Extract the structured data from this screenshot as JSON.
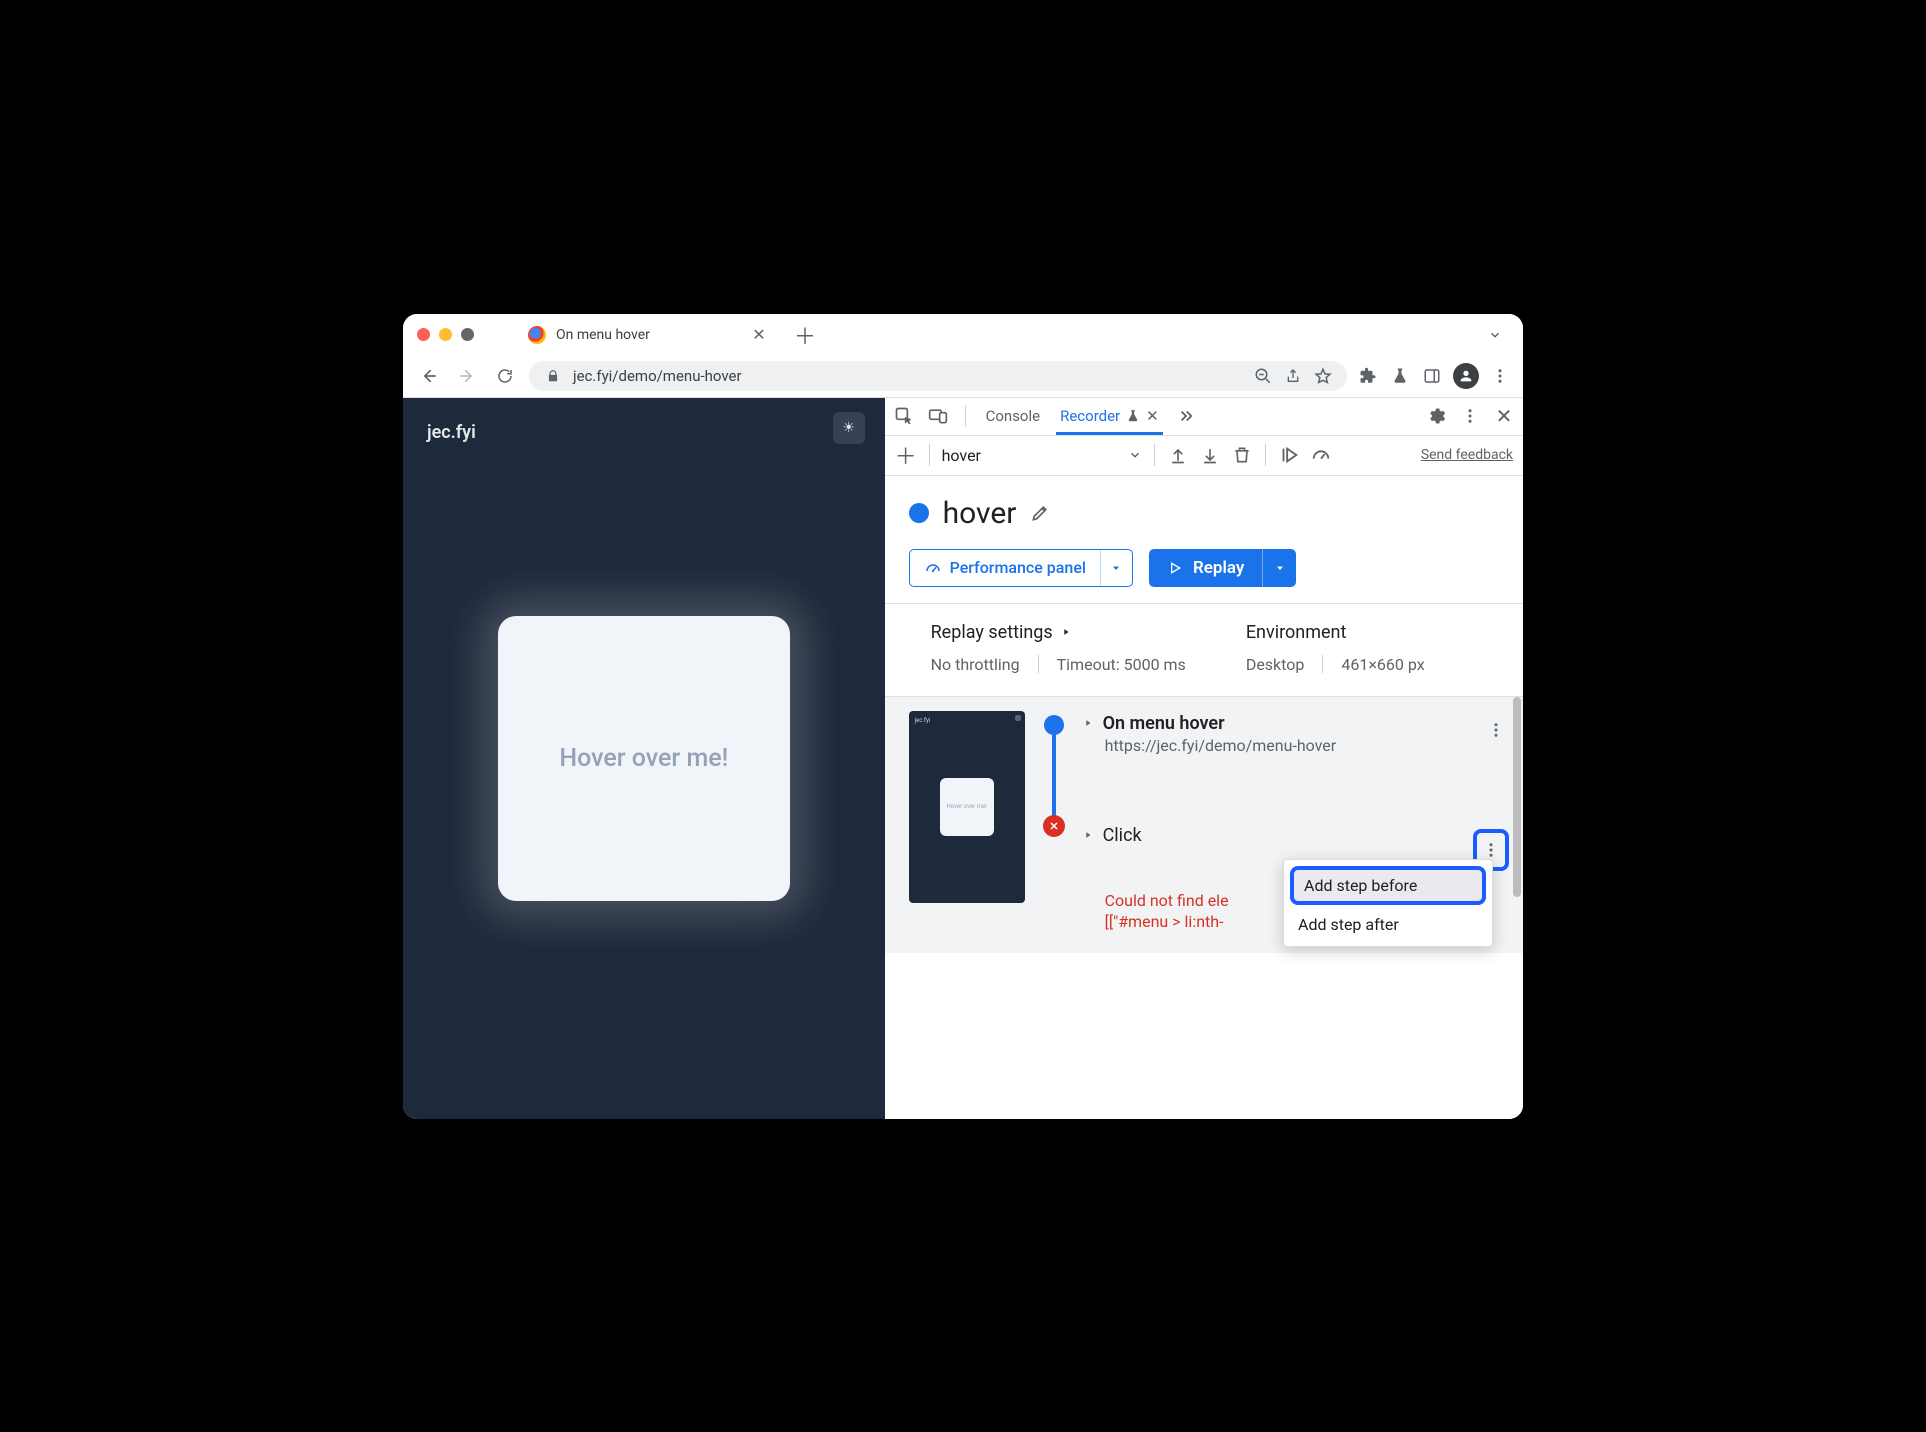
{
  "tab": {
    "title": "On menu hover"
  },
  "toolbar": {
    "url": "jec.fyi/demo/menu-hover"
  },
  "page": {
    "brand": "jec.fyi",
    "card_text": "Hover over me!"
  },
  "devtools": {
    "tabs": {
      "console": "Console",
      "recorder": "Recorder"
    },
    "recording_name": "hover",
    "feedback": "Send feedback",
    "title": "hover",
    "perf_button": "Performance panel",
    "replay_button": "Replay",
    "settings": {
      "replay_head": "Replay settings",
      "throttling": "No throttling",
      "timeout": "Timeout: 5000 ms",
      "env_head": "Environment",
      "device": "Desktop",
      "dims": "461×660 px"
    },
    "steps": {
      "s1_title": "On menu hover",
      "s1_url": "https://jec.fyi/demo/menu-hover",
      "s2_title": "Click",
      "error_l1": "Could not find ele",
      "error_l2": "[[\"#menu > li:nth-"
    },
    "ctx": {
      "before": "Add step before",
      "after": "Add step after"
    },
    "thumb_text": "Hover over me!"
  }
}
